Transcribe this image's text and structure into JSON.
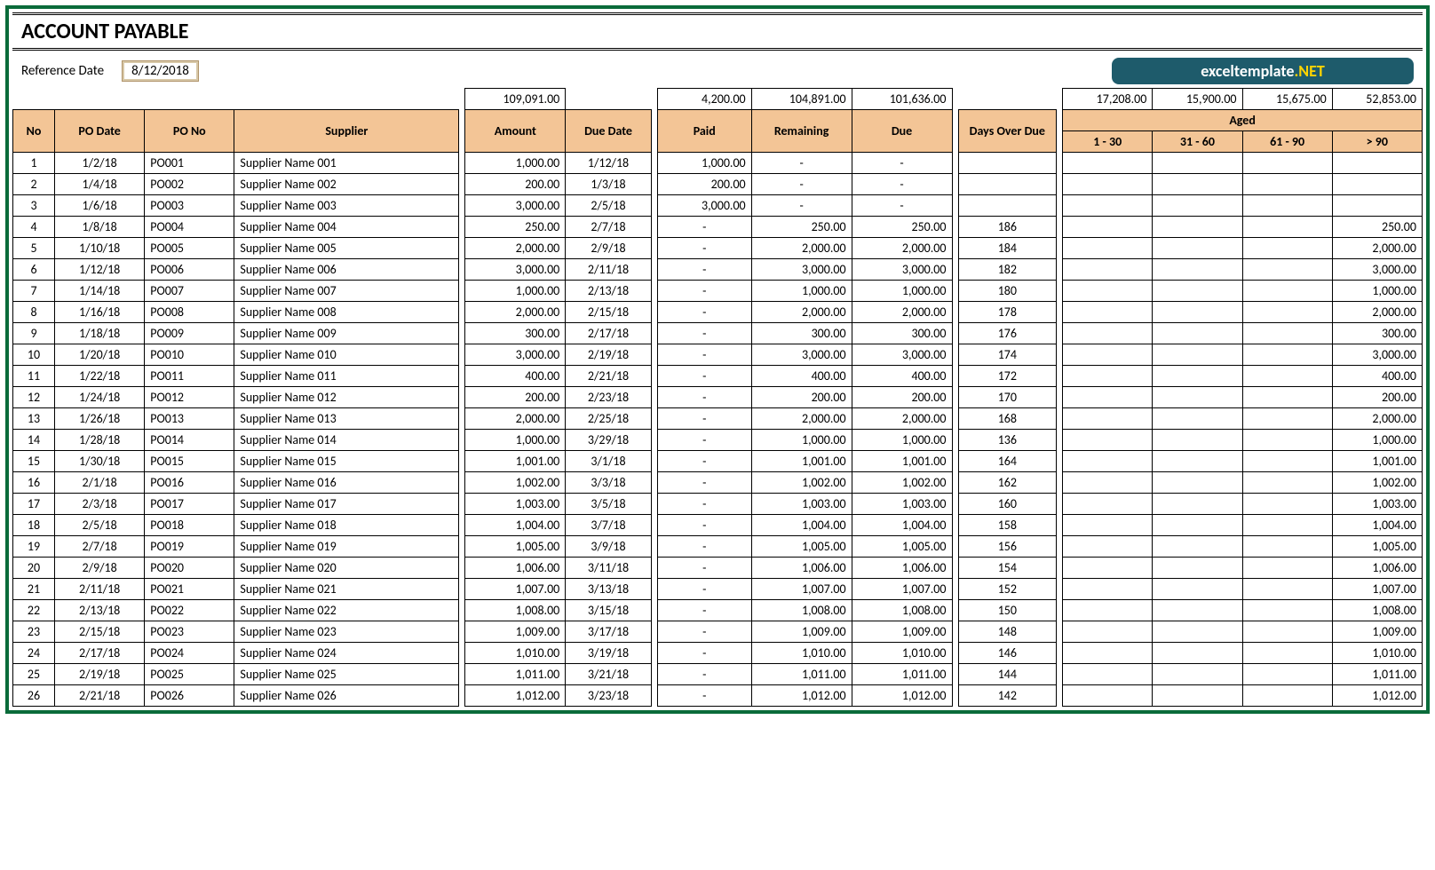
{
  "title": "ACCOUNT PAYABLE",
  "ref_label": "Reference Date",
  "ref_date": "8/12/2018",
  "logo_a": "exceltemplate",
  "logo_b": ".NET",
  "summary": {
    "amount": "109,091.00",
    "paid": "4,200.00",
    "remaining": "104,891.00",
    "due": "101,636.00",
    "aged1": "17,208.00",
    "aged2": "15,900.00",
    "aged3": "15,675.00",
    "aged4": "52,853.00"
  },
  "headers": {
    "no": "No",
    "podate": "PO Date",
    "pono": "PO No",
    "supplier": "Supplier",
    "amount": "Amount",
    "duedate": "Due Date",
    "paid": "Paid",
    "remaining": "Remaining",
    "due": "Due",
    "days": "Days Over Due",
    "aged": "Aged",
    "a1": "1 - 30",
    "a2": "31 - 60",
    "a3": "61 - 90",
    "a4": "> 90"
  },
  "rows": [
    {
      "no": "1",
      "podate": "1/2/18",
      "pono": "PO001",
      "supplier": "Supplier Name 001",
      "amount": "1,000.00",
      "duedate": "1/12/18",
      "paid": "1,000.00",
      "remaining": "-",
      "due": "-",
      "days": "",
      "a1": "",
      "a2": "",
      "a3": "",
      "a4": ""
    },
    {
      "no": "2",
      "podate": "1/4/18",
      "pono": "PO002",
      "supplier": "Supplier Name 002",
      "amount": "200.00",
      "duedate": "1/3/18",
      "paid": "200.00",
      "remaining": "-",
      "due": "-",
      "days": "",
      "a1": "",
      "a2": "",
      "a3": "",
      "a4": ""
    },
    {
      "no": "3",
      "podate": "1/6/18",
      "pono": "PO003",
      "supplier": "Supplier Name 003",
      "amount": "3,000.00",
      "duedate": "2/5/18",
      "paid": "3,000.00",
      "remaining": "-",
      "due": "-",
      "days": "",
      "a1": "",
      "a2": "",
      "a3": "",
      "a4": ""
    },
    {
      "no": "4",
      "podate": "1/8/18",
      "pono": "PO004",
      "supplier": "Supplier Name 004",
      "amount": "250.00",
      "duedate": "2/7/18",
      "paid": "-",
      "remaining": "250.00",
      "due": "250.00",
      "days": "186",
      "a1": "",
      "a2": "",
      "a3": "",
      "a4": "250.00"
    },
    {
      "no": "5",
      "podate": "1/10/18",
      "pono": "PO005",
      "supplier": "Supplier Name 005",
      "amount": "2,000.00",
      "duedate": "2/9/18",
      "paid": "-",
      "remaining": "2,000.00",
      "due": "2,000.00",
      "days": "184",
      "a1": "",
      "a2": "",
      "a3": "",
      "a4": "2,000.00"
    },
    {
      "no": "6",
      "podate": "1/12/18",
      "pono": "PO006",
      "supplier": "Supplier Name 006",
      "amount": "3,000.00",
      "duedate": "2/11/18",
      "paid": "-",
      "remaining": "3,000.00",
      "due": "3,000.00",
      "days": "182",
      "a1": "",
      "a2": "",
      "a3": "",
      "a4": "3,000.00"
    },
    {
      "no": "7",
      "podate": "1/14/18",
      "pono": "PO007",
      "supplier": "Supplier Name 007",
      "amount": "1,000.00",
      "duedate": "2/13/18",
      "paid": "-",
      "remaining": "1,000.00",
      "due": "1,000.00",
      "days": "180",
      "a1": "",
      "a2": "",
      "a3": "",
      "a4": "1,000.00"
    },
    {
      "no": "8",
      "podate": "1/16/18",
      "pono": "PO008",
      "supplier": "Supplier Name 008",
      "amount": "2,000.00",
      "duedate": "2/15/18",
      "paid": "-",
      "remaining": "2,000.00",
      "due": "2,000.00",
      "days": "178",
      "a1": "",
      "a2": "",
      "a3": "",
      "a4": "2,000.00"
    },
    {
      "no": "9",
      "podate": "1/18/18",
      "pono": "PO009",
      "supplier": "Supplier Name 009",
      "amount": "300.00",
      "duedate": "2/17/18",
      "paid": "-",
      "remaining": "300.00",
      "due": "300.00",
      "days": "176",
      "a1": "",
      "a2": "",
      "a3": "",
      "a4": "300.00"
    },
    {
      "no": "10",
      "podate": "1/20/18",
      "pono": "PO010",
      "supplier": "Supplier Name 010",
      "amount": "3,000.00",
      "duedate": "2/19/18",
      "paid": "-",
      "remaining": "3,000.00",
      "due": "3,000.00",
      "days": "174",
      "a1": "",
      "a2": "",
      "a3": "",
      "a4": "3,000.00"
    },
    {
      "no": "11",
      "podate": "1/22/18",
      "pono": "PO011",
      "supplier": "Supplier Name 011",
      "amount": "400.00",
      "duedate": "2/21/18",
      "paid": "-",
      "remaining": "400.00",
      "due": "400.00",
      "days": "172",
      "a1": "",
      "a2": "",
      "a3": "",
      "a4": "400.00"
    },
    {
      "no": "12",
      "podate": "1/24/18",
      "pono": "PO012",
      "supplier": "Supplier Name 012",
      "amount": "200.00",
      "duedate": "2/23/18",
      "paid": "-",
      "remaining": "200.00",
      "due": "200.00",
      "days": "170",
      "a1": "",
      "a2": "",
      "a3": "",
      "a4": "200.00"
    },
    {
      "no": "13",
      "podate": "1/26/18",
      "pono": "PO013",
      "supplier": "Supplier Name 013",
      "amount": "2,000.00",
      "duedate": "2/25/18",
      "paid": "-",
      "remaining": "2,000.00",
      "due": "2,000.00",
      "days": "168",
      "a1": "",
      "a2": "",
      "a3": "",
      "a4": "2,000.00"
    },
    {
      "no": "14",
      "podate": "1/28/18",
      "pono": "PO014",
      "supplier": "Supplier Name 014",
      "amount": "1,000.00",
      "duedate": "3/29/18",
      "paid": "-",
      "remaining": "1,000.00",
      "due": "1,000.00",
      "days": "136",
      "a1": "",
      "a2": "",
      "a3": "",
      "a4": "1,000.00"
    },
    {
      "no": "15",
      "podate": "1/30/18",
      "pono": "PO015",
      "supplier": "Supplier Name 015",
      "amount": "1,001.00",
      "duedate": "3/1/18",
      "paid": "-",
      "remaining": "1,001.00",
      "due": "1,001.00",
      "days": "164",
      "a1": "",
      "a2": "",
      "a3": "",
      "a4": "1,001.00"
    },
    {
      "no": "16",
      "podate": "2/1/18",
      "pono": "PO016",
      "supplier": "Supplier Name 016",
      "amount": "1,002.00",
      "duedate": "3/3/18",
      "paid": "-",
      "remaining": "1,002.00",
      "due": "1,002.00",
      "days": "162",
      "a1": "",
      "a2": "",
      "a3": "",
      "a4": "1,002.00"
    },
    {
      "no": "17",
      "podate": "2/3/18",
      "pono": "PO017",
      "supplier": "Supplier Name 017",
      "amount": "1,003.00",
      "duedate": "3/5/18",
      "paid": "-",
      "remaining": "1,003.00",
      "due": "1,003.00",
      "days": "160",
      "a1": "",
      "a2": "",
      "a3": "",
      "a4": "1,003.00"
    },
    {
      "no": "18",
      "podate": "2/5/18",
      "pono": "PO018",
      "supplier": "Supplier Name 018",
      "amount": "1,004.00",
      "duedate": "3/7/18",
      "paid": "-",
      "remaining": "1,004.00",
      "due": "1,004.00",
      "days": "158",
      "a1": "",
      "a2": "",
      "a3": "",
      "a4": "1,004.00"
    },
    {
      "no": "19",
      "podate": "2/7/18",
      "pono": "PO019",
      "supplier": "Supplier Name 019",
      "amount": "1,005.00",
      "duedate": "3/9/18",
      "paid": "-",
      "remaining": "1,005.00",
      "due": "1,005.00",
      "days": "156",
      "a1": "",
      "a2": "",
      "a3": "",
      "a4": "1,005.00"
    },
    {
      "no": "20",
      "podate": "2/9/18",
      "pono": "PO020",
      "supplier": "Supplier Name 020",
      "amount": "1,006.00",
      "duedate": "3/11/18",
      "paid": "-",
      "remaining": "1,006.00",
      "due": "1,006.00",
      "days": "154",
      "a1": "",
      "a2": "",
      "a3": "",
      "a4": "1,006.00"
    },
    {
      "no": "21",
      "podate": "2/11/18",
      "pono": "PO021",
      "supplier": "Supplier Name 021",
      "amount": "1,007.00",
      "duedate": "3/13/18",
      "paid": "-",
      "remaining": "1,007.00",
      "due": "1,007.00",
      "days": "152",
      "a1": "",
      "a2": "",
      "a3": "",
      "a4": "1,007.00"
    },
    {
      "no": "22",
      "podate": "2/13/18",
      "pono": "PO022",
      "supplier": "Supplier Name 022",
      "amount": "1,008.00",
      "duedate": "3/15/18",
      "paid": "-",
      "remaining": "1,008.00",
      "due": "1,008.00",
      "days": "150",
      "a1": "",
      "a2": "",
      "a3": "",
      "a4": "1,008.00"
    },
    {
      "no": "23",
      "podate": "2/15/18",
      "pono": "PO023",
      "supplier": "Supplier Name 023",
      "amount": "1,009.00",
      "duedate": "3/17/18",
      "paid": "-",
      "remaining": "1,009.00",
      "due": "1,009.00",
      "days": "148",
      "a1": "",
      "a2": "",
      "a3": "",
      "a4": "1,009.00"
    },
    {
      "no": "24",
      "podate": "2/17/18",
      "pono": "PO024",
      "supplier": "Supplier Name 024",
      "amount": "1,010.00",
      "duedate": "3/19/18",
      "paid": "-",
      "remaining": "1,010.00",
      "due": "1,010.00",
      "days": "146",
      "a1": "",
      "a2": "",
      "a3": "",
      "a4": "1,010.00"
    },
    {
      "no": "25",
      "podate": "2/19/18",
      "pono": "PO025",
      "supplier": "Supplier Name 025",
      "amount": "1,011.00",
      "duedate": "3/21/18",
      "paid": "-",
      "remaining": "1,011.00",
      "due": "1,011.00",
      "days": "144",
      "a1": "",
      "a2": "",
      "a3": "",
      "a4": "1,011.00"
    },
    {
      "no": "26",
      "podate": "2/21/18",
      "pono": "PO026",
      "supplier": "Supplier Name 026",
      "amount": "1,012.00",
      "duedate": "3/23/18",
      "paid": "-",
      "remaining": "1,012.00",
      "due": "1,012.00",
      "days": "142",
      "a1": "",
      "a2": "",
      "a3": "",
      "a4": "1,012.00"
    }
  ]
}
